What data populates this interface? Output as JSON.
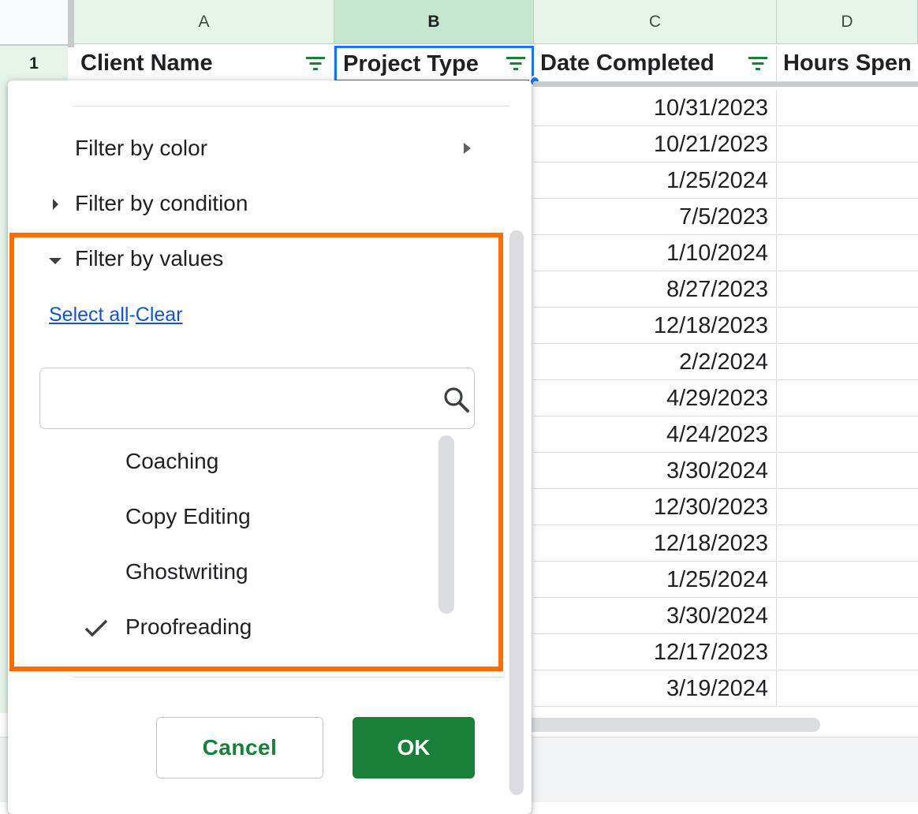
{
  "columns": [
    {
      "letter": "A",
      "header": "Client Name"
    },
    {
      "letter": "B",
      "header": "Project Type"
    },
    {
      "letter": "C",
      "header": "Date Completed"
    },
    {
      "letter": "D",
      "header": "Hours Spen"
    }
  ],
  "row_header": "1",
  "selected_column": "B",
  "date_completed_values": [
    "10/31/2023",
    "10/21/2023",
    "1/25/2024",
    "7/5/2023",
    "1/10/2024",
    "8/27/2023",
    "12/18/2023",
    "2/2/2024",
    "4/29/2023",
    "4/24/2023",
    "3/30/2024",
    "12/30/2023",
    "12/18/2023",
    "1/25/2024",
    "3/30/2024",
    "12/17/2023",
    "3/19/2024"
  ],
  "filter_menu": {
    "filter_by_color": "Filter by color",
    "filter_by_condition": "Filter by condition",
    "filter_by_values": "Filter by values",
    "select_all": "Select all",
    "separator": "-",
    "clear": "Clear",
    "search_value": "",
    "search_placeholder": "",
    "values": [
      {
        "label": "Coaching",
        "checked": false
      },
      {
        "label": "Copy Editing",
        "checked": false
      },
      {
        "label": "Ghostwriting",
        "checked": false
      },
      {
        "label": "Proofreading",
        "checked": true
      }
    ],
    "cancel": "Cancel",
    "ok": "OK"
  },
  "colors": {
    "accent_green": "#188038",
    "highlight_orange": "#ff6d00",
    "link_blue": "#1155cc",
    "selection_blue": "#1a73e8"
  }
}
